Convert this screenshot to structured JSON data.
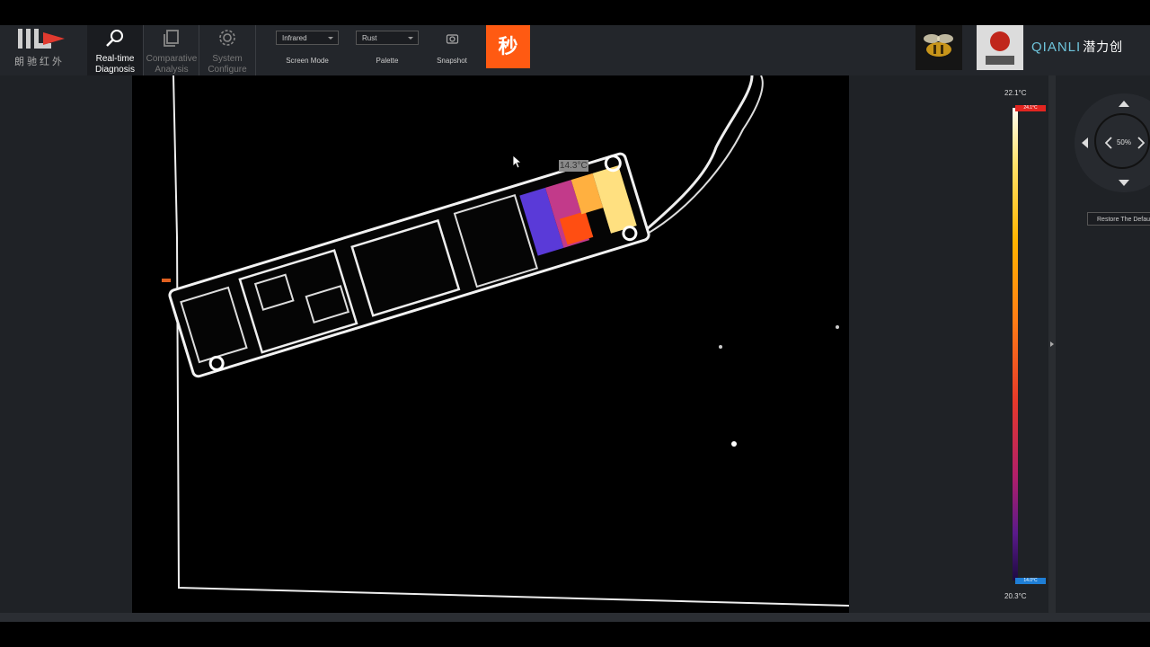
{
  "app": {
    "logo_text": "朗驰红外",
    "brand_name": "QIANLI",
    "brand_cn": "潜力创"
  },
  "nav": [
    {
      "label_line1": "Real-time",
      "label_line2": "Diagnosis",
      "icon": "search-icon",
      "active": true
    },
    {
      "label_line1": "Comparative",
      "label_line2": "Analysis",
      "icon": "copy-icon",
      "active": false
    },
    {
      "label_line1": "System",
      "label_line2": "Configure",
      "icon": "gear-icon",
      "active": false
    }
  ],
  "toolbar": {
    "screen_mode_value": "Infrared",
    "screen_mode_label": "Screen Mode",
    "palette_value": "Rust",
    "palette_label": "Palette",
    "snapshot_label": "Snapshot",
    "seconds_button": "秒"
  },
  "thermal": {
    "cursor_temp": "14.3°C",
    "scale_max": "22.1°C",
    "scale_min": "20.3°C",
    "marker_high": "24.1°C",
    "marker_low": "14.0°C"
  },
  "view": {
    "zoom": "50%",
    "restore_label": "Restore The Default"
  },
  "colors": {
    "accent_orange": "#ff5a12",
    "brand_cyan": "#6ec3da",
    "marker_high": "#e22520",
    "marker_low": "#1f7fd6"
  }
}
